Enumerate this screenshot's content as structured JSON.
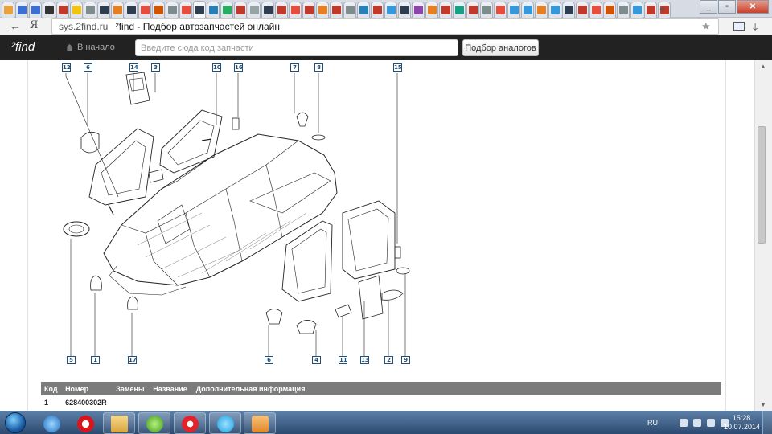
{
  "browser": {
    "url": "sys.2find.ru",
    "page_title": "²find - Подбор автозапчастей онлайн",
    "tab_favicon_colors": [
      "#e8a33c",
      "#3b6fd4",
      "#3b6fd4",
      "#333333",
      "#c0392b",
      "#f1c40f",
      "#7f8c8d",
      "#2c3e50",
      "#e67e22",
      "#2c3e50",
      "#e74c3c",
      "#d35400",
      "#7f8c8d",
      "#e74c3c",
      "#2c3e50",
      "#2980b9",
      "#27ae60",
      "#c0392b",
      "#95a5a6",
      "#2c3e50",
      "#c0392b",
      "#e74c3c",
      "#c0392b",
      "#e67e22",
      "#c0392b",
      "#7f8c8d",
      "#2980b9",
      "#c0392b",
      "#3498db",
      "#2c3e50",
      "#8e44ad",
      "#e67e22",
      "#c0392b",
      "#16a085",
      "#c0392b",
      "#7f8c8d",
      "#e74c3c",
      "#3498db",
      "#3498db",
      "#e67e22",
      "#3498db",
      "#2c3e50",
      "#c0392b",
      "#e74c3c",
      "#d35400",
      "#7f8c8d",
      "#3498db",
      "#c0392b",
      "#c0392b"
    ]
  },
  "site": {
    "logo": "²find",
    "home_link": "В начало",
    "search_placeholder": "Введите сюда код запчасти",
    "search_button": "Подбор аналогов"
  },
  "diagram": {
    "labels_top": [
      "12",
      "6",
      "14",
      "3",
      "10",
      "16",
      "7",
      "8",
      "15"
    ],
    "labels_bottom": [
      "5",
      "1",
      "17",
      "6",
      "4",
      "11",
      "13",
      "2",
      "9"
    ]
  },
  "table": {
    "headers": [
      "Код",
      "Номер",
      "Замены",
      "Название",
      "Дополнительная информация"
    ],
    "rows": [
      [
        "1",
        "628400302R",
        "",
        "",
        ""
      ]
    ]
  },
  "taskbar": {
    "language": "RU",
    "time": "15:28",
    "date": "10.07.2014"
  }
}
